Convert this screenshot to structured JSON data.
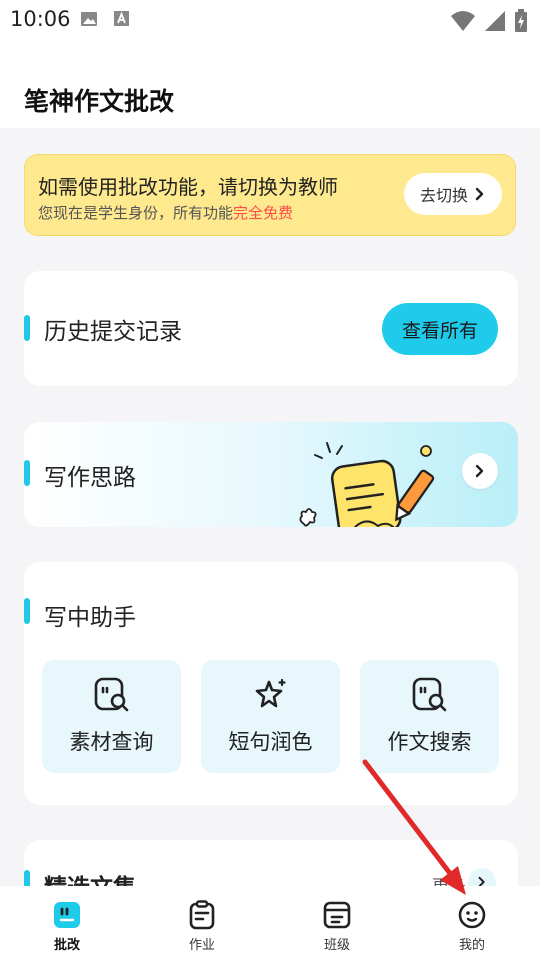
{
  "status": {
    "time": "10:06",
    "icons_left": [
      "image-icon",
      "a-icon"
    ],
    "icons_right": [
      "wifi-icon",
      "signal-icon",
      "battery-charging-icon"
    ]
  },
  "header": {
    "title": "笔神作文批改"
  },
  "notice": {
    "title": "如需使用批改功能，请切换为教师",
    "sub_prefix": "您现在是学生身份，所有功能",
    "sub_highlight": "完全免费",
    "switch_label": "去切换",
    "bg_color": "#ffe98e",
    "highlight_color": "#ff4b4b"
  },
  "history": {
    "title": "历史提交记录",
    "button_label": "查看所有"
  },
  "idea": {
    "title": "写作思路"
  },
  "assistant": {
    "title": "写中助手",
    "tools": [
      {
        "label": "素材查询",
        "icon": "quote-search-icon"
      },
      {
        "label": "短句润色",
        "icon": "sparkle-star-icon"
      },
      {
        "label": "作文搜索",
        "icon": "quote-search-icon"
      }
    ]
  },
  "featured": {
    "title": "精选文集",
    "more_label": "更多"
  },
  "tabbar": {
    "tabs": [
      {
        "label": "批改",
        "icon": "quote-tab-icon",
        "active": true
      },
      {
        "label": "作业",
        "icon": "clipboard-icon",
        "active": false
      },
      {
        "label": "班级",
        "icon": "class-icon",
        "active": false
      },
      {
        "label": "我的",
        "icon": "smiley-icon",
        "active": false
      }
    ]
  },
  "accent_color": "#1fcbea"
}
